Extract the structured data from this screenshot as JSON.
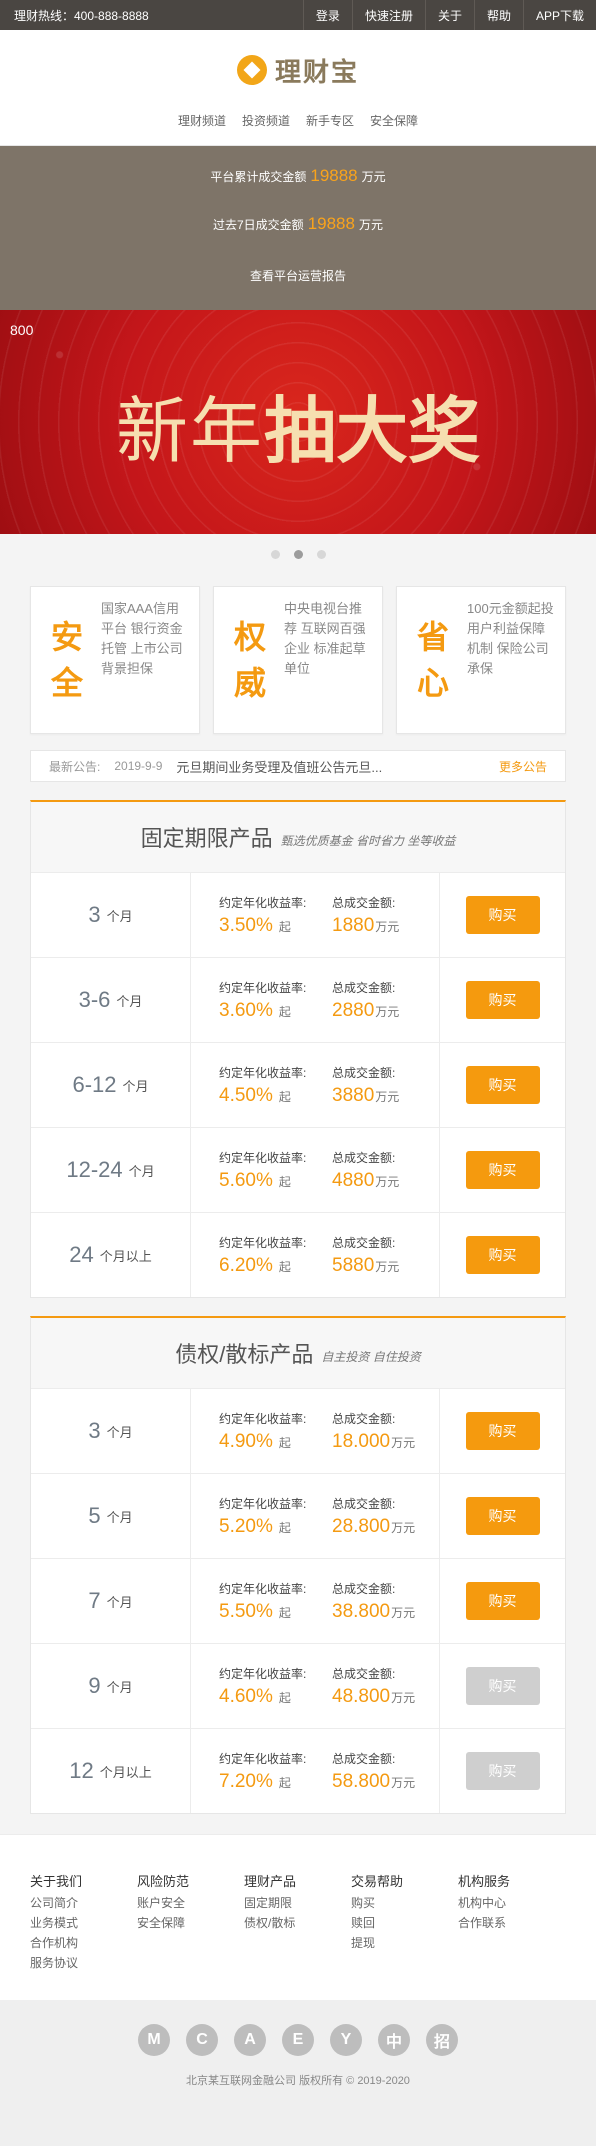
{
  "topbar": {
    "hotline": "理财热线：400-888-8888",
    "links": [
      "登录",
      "快速注册",
      "关于",
      "帮助",
      "APP下载"
    ]
  },
  "header": {
    "brand": "理财宝",
    "nav": [
      "理财频道",
      "投资频道",
      "新手专区",
      "安全保障"
    ]
  },
  "stats": {
    "total_prefix": "平台累计成交金额",
    "total_value": "19888",
    "total_unit": "万元",
    "week_prefix": "过去7日成交金额",
    "week_value": "19888",
    "week_unit": "万元",
    "report_link": "查看平台运营报告"
  },
  "banner": {
    "tag": "800",
    "headline_light": "新年",
    "headline_bold": "抽大奖"
  },
  "features": [
    {
      "big": "安全",
      "lines": "国家AAA信用平台 银行资金托管 上市公司背景担保"
    },
    {
      "big": "权威",
      "lines": "中央电视台推荐 互联网百强企业 标准起草单位"
    },
    {
      "big": "省心",
      "lines": "100元金额起投 用户利益保障机制 保险公司承保"
    }
  ],
  "notice": {
    "label": "最新公告:",
    "date": "2019-9-9",
    "text": "元旦期间业务受理及值班公告元旦...",
    "more": "更多公告"
  },
  "fixed": {
    "title": "固定期限产品",
    "subtitle": "甄选优质基金  省时省力  坐等收益",
    "rows": [
      {
        "term": "3",
        "unit": "个月",
        "rate": "3.50%",
        "amount": "1880",
        "enabled": true
      },
      {
        "term": "3-6",
        "unit": "个月",
        "rate": "3.60%",
        "amount": "2880",
        "enabled": true
      },
      {
        "term": "6-12",
        "unit": "个月",
        "rate": "4.50%",
        "amount": "3880",
        "enabled": true
      },
      {
        "term": "12-24",
        "unit": "个月",
        "rate": "5.60%",
        "amount": "4880",
        "enabled": true
      },
      {
        "term": "24",
        "unit": "个月以上",
        "rate": "6.20%",
        "amount": "5880",
        "enabled": true
      }
    ]
  },
  "debt": {
    "title": "债权/散标产品",
    "subtitle": "自主投资  自住投资",
    "rows": [
      {
        "term": "3",
        "unit": "个月",
        "rate": "4.90%",
        "amount": "18.000",
        "enabled": true
      },
      {
        "term": "5",
        "unit": "个月",
        "rate": "5.20%",
        "amount": "28.800",
        "enabled": true
      },
      {
        "term": "7",
        "unit": "个月",
        "rate": "5.50%",
        "amount": "38.800",
        "enabled": true
      },
      {
        "term": "9",
        "unit": "个月",
        "rate": "4.60%",
        "amount": "48.800",
        "enabled": false
      },
      {
        "term": "12",
        "unit": "个月以上",
        "rate": "7.20%",
        "amount": "58.800",
        "enabled": false
      }
    ]
  },
  "labels": {
    "rate": "约定年化收益率:",
    "amount": "总成交金额:",
    "rate_suffix": "起",
    "amount_suffix": "万元",
    "buy": "购买"
  },
  "footer": {
    "columns": [
      {
        "title": "关于我们",
        "items": [
          "公司简介",
          "业务模式",
          "合作机构",
          "服务协议"
        ]
      },
      {
        "title": "风险防范",
        "items": [
          "账户安全",
          "安全保障"
        ]
      },
      {
        "title": "理财产品",
        "items": [
          "固定期限",
          "债权/散标"
        ]
      },
      {
        "title": "交易帮助",
        "items": [
          "购买",
          "赎回",
          "提现"
        ]
      },
      {
        "title": "机构服务",
        "items": [
          "机构中心",
          "合作联系"
        ]
      }
    ],
    "badges": [
      "M",
      "C",
      "A",
      "E",
      "Y",
      "中",
      "招"
    ],
    "copyright": "北京某互联网金融公司 版权所有 © 2019-2020"
  },
  "colors": {
    "accent": "#f49a11",
    "topbar": "#4a4642",
    "stats_bg": "#7e7468",
    "banner": "#c4161a"
  }
}
